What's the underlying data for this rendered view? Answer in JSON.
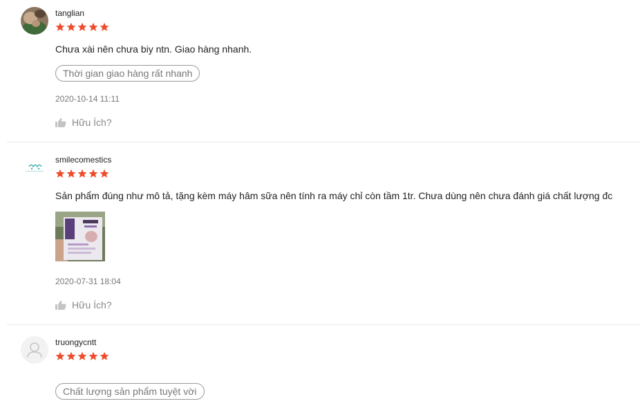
{
  "reviews": [
    {
      "username": "tanglian",
      "rating": 5,
      "comment": "Chưa xài nên chưa biy ntn. Giao hàng nhanh.",
      "tag": "Thời gian giao hàng rất nhanh",
      "date": "2020-10-14 11:11",
      "helpful_label": "Hữu Ích?"
    },
    {
      "username": "smilecomestics",
      "rating": 5,
      "comment": "Sản phẩm đúng như mô tả, tặng kèm máy hâm sữa nên tính ra máy chỉ còn tầm 1tr. Chưa dùng nên chưa đánh giá chất lượng đc",
      "date": "2020-07-31 18:04",
      "helpful_label": "Hữu Ích?"
    },
    {
      "username": "truongycntt",
      "rating": 5,
      "tag": "Chất lượng sản phẩm tuyệt vời"
    }
  ],
  "colors": {
    "star": "#ee4d2d",
    "tag_border": "#999999",
    "muted_text": "#777777",
    "divider": "#e8e8e8"
  },
  "icons": {
    "star": "star-icon",
    "helpful": "thumbs-up-icon",
    "default_avatar": "user-silhouette-icon"
  }
}
